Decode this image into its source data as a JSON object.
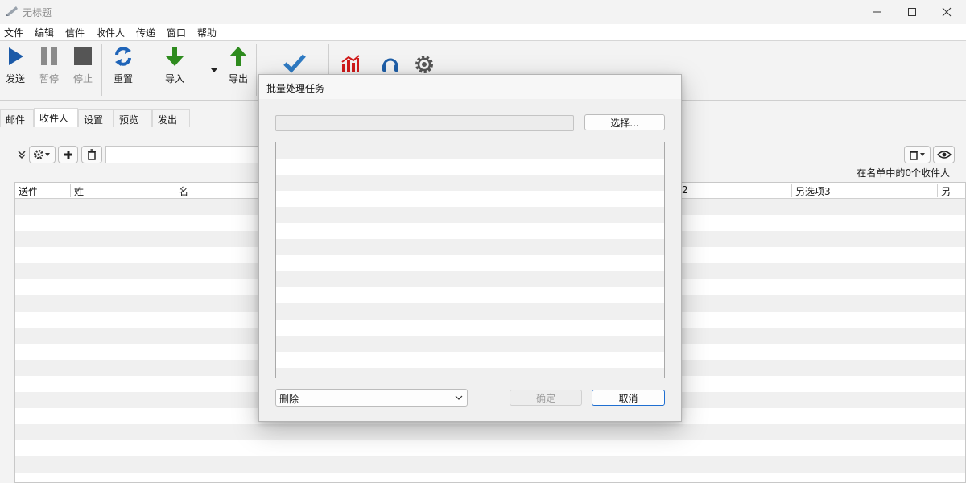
{
  "window": {
    "title": "无标题",
    "icons": {
      "app": "app-icon",
      "minimize": "minimize-icon",
      "maximize": "maximize-icon",
      "close": "close-icon"
    }
  },
  "menu": [
    "文件",
    "编辑",
    "信件",
    "收件人",
    "传递",
    "窗口",
    "帮助"
  ],
  "toolbar": {
    "send": "发送",
    "pause": "暂停",
    "stop": "停止",
    "reset": "重置",
    "import": "导入",
    "export": "导出",
    "icons": [
      "play-icon",
      "pause-icon",
      "stop-icon",
      "refresh-icon",
      "import-arrow-icon",
      "dropdown-caret-icon",
      "export-arrow-icon",
      "check-icon",
      "chart-icon",
      "headset-icon",
      "gear-icon"
    ]
  },
  "tabs": [
    {
      "label": "邮件",
      "active": false
    },
    {
      "label": "收件人",
      "active": true
    },
    {
      "label": "设置",
      "active": false
    },
    {
      "label": "预览",
      "active": false
    },
    {
      "label": "发出",
      "active": false
    }
  ],
  "recipients": {
    "count_text": "在名单中的0个收件人",
    "columns": [
      "送件",
      "姓",
      "名",
      "2",
      "另选项3",
      "另"
    ]
  },
  "dialog": {
    "title": "批量处理任务",
    "file_value": "",
    "choose_label": "选择...",
    "action_value": "删除",
    "ok_label": "确定",
    "cancel_label": "取消"
  },
  "colors": {
    "accent": "#1f6fd1",
    "play": "#1b5aa8",
    "import": "#2e8b1e",
    "chart": "#d11a1a"
  }
}
